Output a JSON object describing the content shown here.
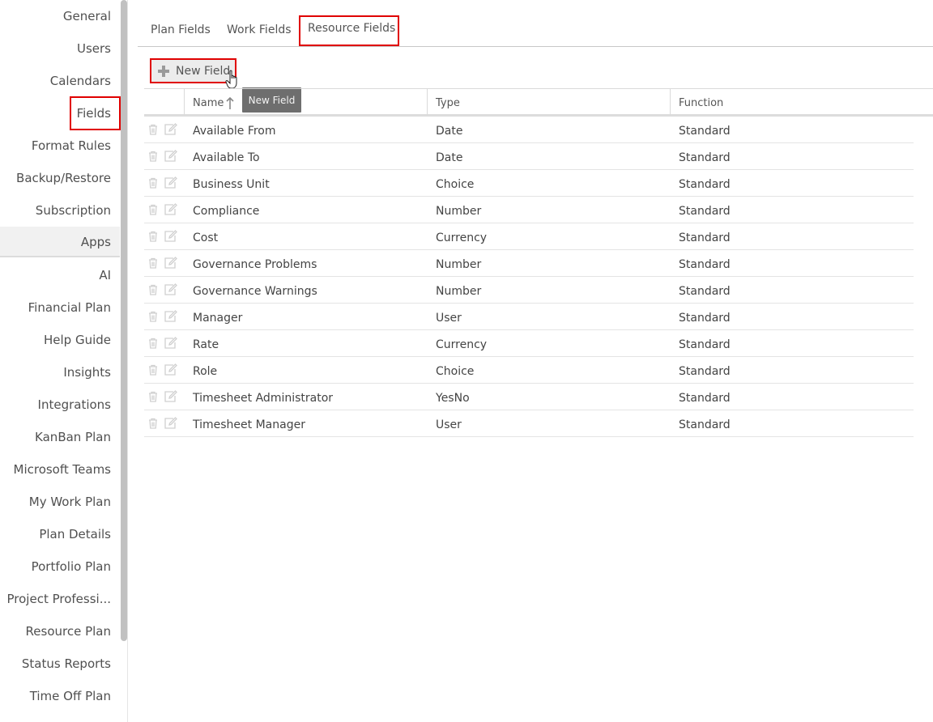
{
  "sidebar": {
    "items": [
      {
        "label": "General"
      },
      {
        "label": "Users"
      },
      {
        "label": "Calendars"
      },
      {
        "label": "Fields"
      },
      {
        "label": "Format Rules"
      },
      {
        "label": "Backup/Restore"
      },
      {
        "label": "Subscription"
      },
      {
        "label": "Apps"
      },
      {
        "label": "AI"
      },
      {
        "label": "Financial Plan"
      },
      {
        "label": "Help Guide"
      },
      {
        "label": "Insights"
      },
      {
        "label": "Integrations"
      },
      {
        "label": "KanBan Plan"
      },
      {
        "label": "Microsoft Teams"
      },
      {
        "label": "My Work Plan"
      },
      {
        "label": "Plan Details"
      },
      {
        "label": "Portfolio Plan"
      },
      {
        "label": "Project Professi..."
      },
      {
        "label": "Resource Plan"
      },
      {
        "label": "Status Reports"
      },
      {
        "label": "Time Off Plan"
      }
    ]
  },
  "tabs": [
    {
      "label": "Plan Fields"
    },
    {
      "label": "Work Fields"
    },
    {
      "label": "Resource Fields"
    }
  ],
  "toolbar": {
    "new_field_label": "New Field",
    "tooltip": "New Field"
  },
  "grid": {
    "columns": [
      "Name",
      "Type",
      "Function"
    ],
    "rows": [
      {
        "name": "Available From",
        "type": "Date",
        "function": "Standard"
      },
      {
        "name": "Available To",
        "type": "Date",
        "function": "Standard"
      },
      {
        "name": "Business Unit",
        "type": "Choice",
        "function": "Standard"
      },
      {
        "name": "Compliance",
        "type": "Number",
        "function": "Standard"
      },
      {
        "name": "Cost",
        "type": "Currency",
        "function": "Standard"
      },
      {
        "name": "Governance Problems",
        "type": "Number",
        "function": "Standard"
      },
      {
        "name": "Governance Warnings",
        "type": "Number",
        "function": "Standard"
      },
      {
        "name": "Manager",
        "type": "User",
        "function": "Standard"
      },
      {
        "name": "Rate",
        "type": "Currency",
        "function": "Standard"
      },
      {
        "name": "Role",
        "type": "Choice",
        "function": "Standard"
      },
      {
        "name": "Timesheet Administrator",
        "type": "YesNo",
        "function": "Standard"
      },
      {
        "name": "Timesheet Manager",
        "type": "User",
        "function": "Standard"
      }
    ]
  },
  "colors": {
    "highlight": "#e00000",
    "tooltip_bg": "#6e6e6e",
    "icon_gray": "#d4d4d4"
  }
}
